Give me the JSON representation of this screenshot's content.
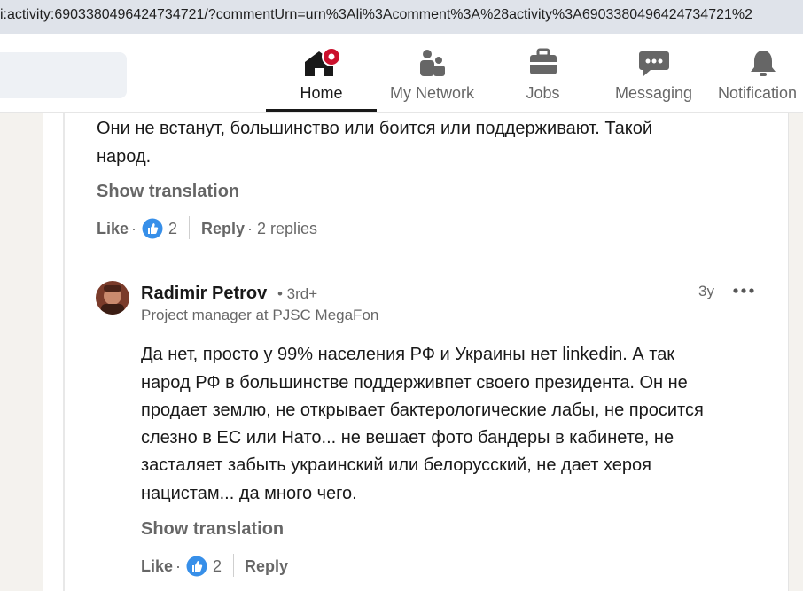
{
  "browser": {
    "url": "i:activity:6903380496424734721/?commentUrn=urn%3Ali%3Acomment%3A%28activity%3A6903380496424734721%2"
  },
  "nav": {
    "items": [
      {
        "label": "Home",
        "icon": "home-icon",
        "badge": "notification-dot"
      },
      {
        "label": "My Network",
        "icon": "people-icon"
      },
      {
        "label": "Jobs",
        "icon": "briefcase-icon"
      },
      {
        "label": "Messaging",
        "icon": "chat-bubble-icon"
      },
      {
        "label": "Notification",
        "icon": "bell-icon"
      }
    ],
    "active_color": "#191919",
    "badge_color": "#cb112d"
  },
  "comment1": {
    "lines": [
      "Они не встанут, большинство или боится или поддерживают. Такой",
      "народ."
    ],
    "show_translation": "Show translation",
    "actions": {
      "like": "Like",
      "like_sep": "·",
      "reactions_count": "2",
      "reply": "Reply",
      "replies_sep": "·",
      "replies": "2 replies"
    }
  },
  "reply1": {
    "author": "Radimir Petrov",
    "degree": "• 3rd+",
    "headline": "Project manager at PJSC MegaFon",
    "time": "3y",
    "lines": [
      "Да нет, просто у 99% населения РФ и Украины нет linkedin. А так",
      "народ РФ в большинстве поддерживпет своего президента. Он не",
      "продает землю, не открывает бактерологические лабы, не просится",
      "слезно в ЕС или Нато... не вешает фото бандеры в кабинете, не",
      "засталяет забыть украинский или белорусский, не дает хероя",
      "нацистам... да много чего."
    ],
    "show_translation": "Show translation",
    "actions": {
      "like": "Like",
      "like_sep": "·",
      "reactions_count": "2",
      "reply": "Reply"
    }
  },
  "colors": {
    "like_blue": "#378fe9",
    "text_primary": "rgba(0,0,0,0.9)",
    "text_secondary": "rgba(0,0,0,0.6)"
  }
}
